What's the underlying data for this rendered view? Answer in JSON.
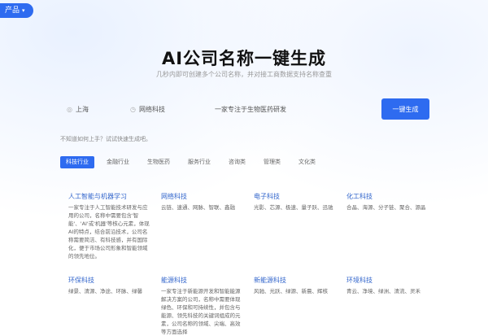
{
  "top_button": {
    "label": "产品",
    "icon": "chevron-down-icon"
  },
  "hero": {
    "title": "AI公司名称一键生成",
    "subtitle": "几秒内即可创建多个公司名称，并对接工商数据支持名称查重"
  },
  "search": {
    "city": "上海",
    "industry": "网络科技",
    "keyword": "一家专注于生物医药研发",
    "generate_label": "一键生成"
  },
  "hint": "不知道如何上手？试试快速生成吧。",
  "tabs": [
    "科技行业",
    "金融行业",
    "生物医药",
    "服务行业",
    "咨询类",
    "管理类",
    "文化类"
  ],
  "cards": [
    {
      "name": "人工智能与机器学习",
      "desc": "一家专注于人工智能技术研发与应用的公司，名称中需要包含'智能'、'AI'或'机器'等核心元素，体现AI的特点，结合前沿技术，公司名称需要简洁、有科技感，并有国际化，便于市场公司形象和智能领域的领先地位。"
    },
    {
      "name": "网络科技",
      "desc": "云链、速通、网脉、智联、鑫融"
    },
    {
      "name": "电子科技",
      "desc": "光影、芯源、极速、量子跃、迅驰"
    },
    {
      "name": "化工科技",
      "desc": "合晶、海源、分子链、聚合、源晶"
    },
    {
      "name": "环保科技",
      "desc": "绿景、清源、净途、环脉、绿馨"
    },
    {
      "name": "能源科技",
      "desc": "一家专注于新能源开发和智能能源解决方案的公司，名称中需要体现绿色、环保和可持续性，并包含与能源、领先科技的关键词组成的元素，公司名称的领域、尖端、高效等方面选择"
    },
    {
      "name": "新能源科技",
      "desc": "风驰、光跃、绿源、新晨、辉核"
    },
    {
      "name": "环境科技",
      "desc": "青云、净境、绿洲、清流、灵禾"
    }
  ]
}
